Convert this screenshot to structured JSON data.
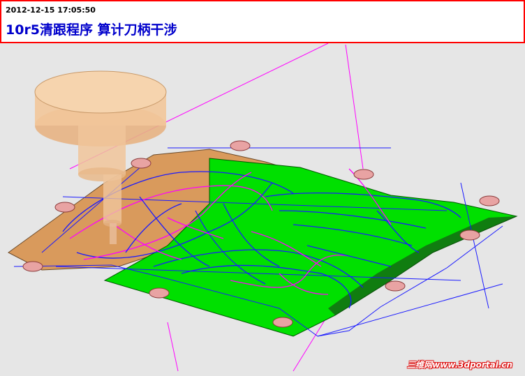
{
  "header": {
    "timestamp": "2012-12-15 17:05:50",
    "title": "10r5清跟程序 算计刀柄干涉"
  },
  "watermark": "三维网www.3dportal.cn",
  "colors": {
    "header_border": "#ff0000",
    "title": "#0000cc",
    "viewport_bg": "#e6e6e6",
    "surface_green": "#00e000",
    "surface_tan": "#d99a5c",
    "toolpath_magenta": "#ff00ff",
    "toolpath_blue": "#1a1aff",
    "clamp_pad": "#e8a3a3",
    "tool_holder": "#f2c79a"
  },
  "icons": {
    "tool_holder": "tool-holder-model",
    "clamp": "clamp-pad"
  }
}
